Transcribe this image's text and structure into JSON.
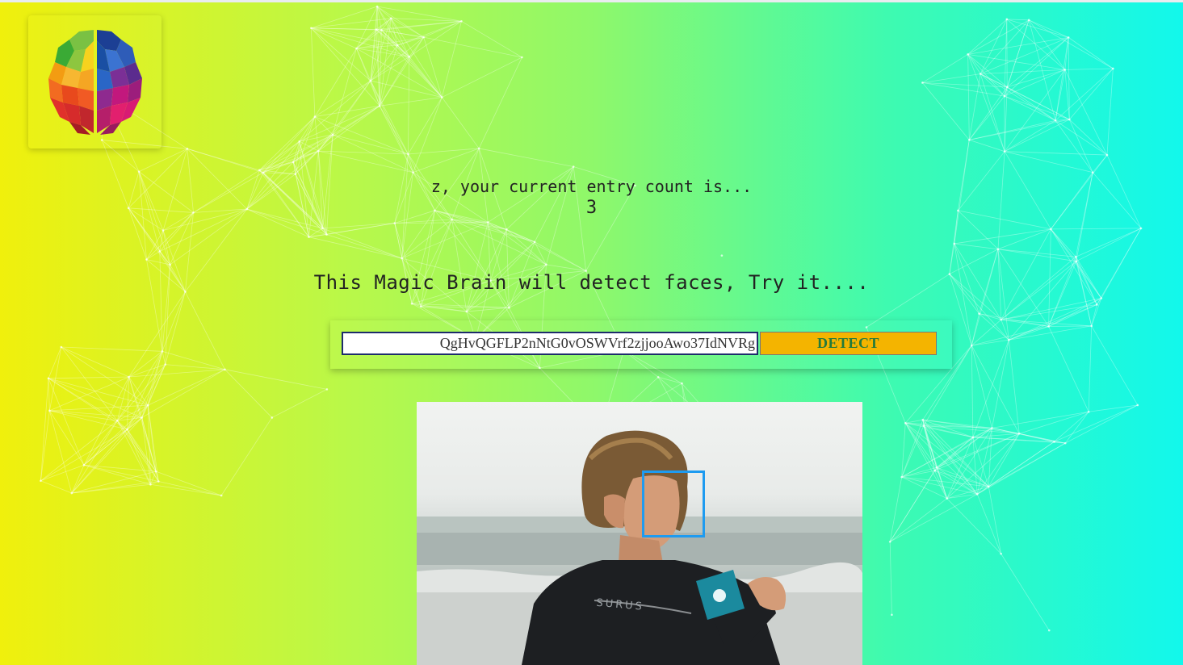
{
  "logo": {
    "icon": "brain-icon"
  },
  "entry": {
    "greeting": "z, your current entry count is...",
    "count": "3"
  },
  "tagline": "This Magic Brain will detect faces, Try it....",
  "form": {
    "url_value": "QgHvQGFLP2nNtG0vOSWVrf2zjjooAwo37IdNVRg",
    "detect_label": "DETECT"
  },
  "result": {
    "image_icon": "surfer-photo",
    "face_box_color": "#1e9bf0"
  },
  "colors": {
    "detect_button": "#f4b400",
    "detect_text": "#237a3b",
    "gradient_left": "#f0f00c",
    "gradient_right": "#12f8ec"
  }
}
